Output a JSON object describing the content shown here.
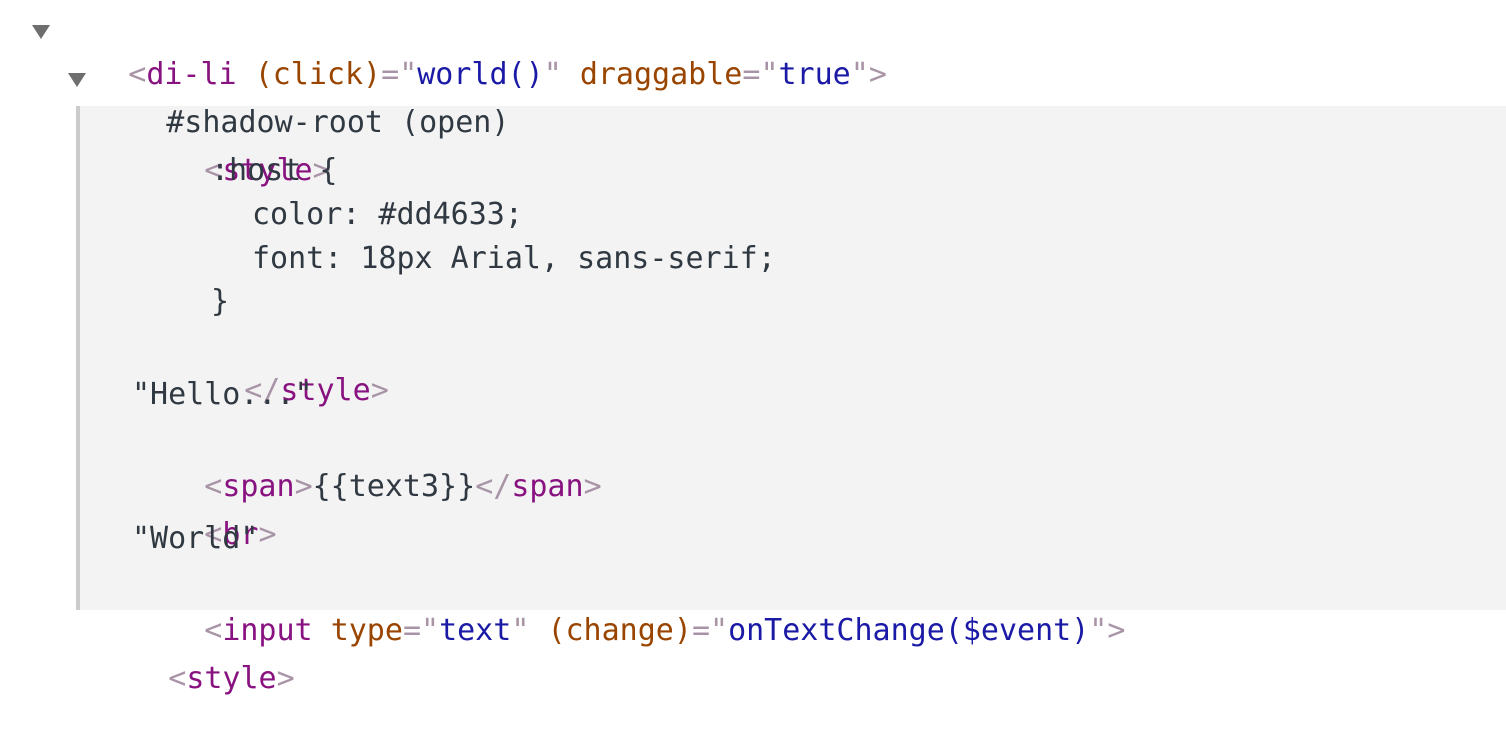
{
  "elements_panel": {
    "root": {
      "open": "<",
      "tag": "di-li",
      "attr1_name": "(click)",
      "eq": "=",
      "q": "\"",
      "attr1_value": "world()",
      "attr2_name": "draggable",
      "attr2_value": "true",
      "close": ">"
    },
    "shadow_root_label": "#shadow-root (open)",
    "style_open": {
      "lt": "<",
      "tag": "style",
      "gt": ">"
    },
    "css_lines": [
      ":host {",
      "color: #dd4633;",
      "font: 18px Arial, sans-serif;",
      "}"
    ],
    "style_close": {
      "lt": "</",
      "tag": "style",
      "gt": ">"
    },
    "text_hello": "\"Hello...\"",
    "span_line": {
      "lt": "<",
      "tag": "span",
      "gt": ">",
      "content": "{{text3}}",
      "close_lt": "</",
      "close_tag": "span",
      "close_gt": ">"
    },
    "br_line": {
      "lt": "<",
      "tag": "br",
      "gt": ">"
    },
    "text_world": "\"World\"",
    "input_line": {
      "lt": "<",
      "tag": "input",
      "attr1_name": "type",
      "eq": "=",
      "q": "\"",
      "attr1_value": "text",
      "attr2_name": "(change)",
      "attr2_value": "onTextChange($event)",
      "gt": ">"
    },
    "bottom_style": {
      "lt": "<",
      "tag": "style",
      "gt": ">"
    }
  }
}
